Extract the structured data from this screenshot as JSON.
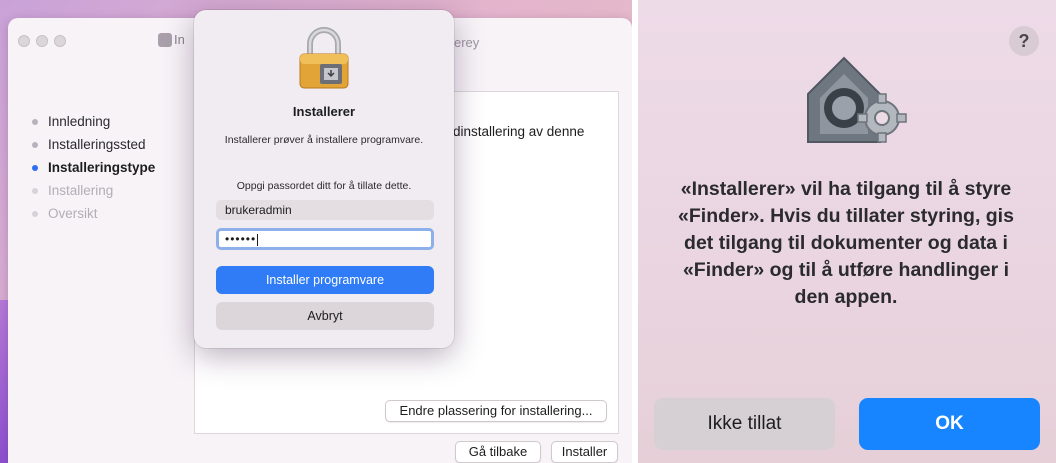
{
  "installer": {
    "window_title_left": "In",
    "window_title_right": "erey",
    "steps": [
      {
        "label": "Innledning",
        "state": "done"
      },
      {
        "label": "Installeringssted",
        "state": "done"
      },
      {
        "label": "Installeringstype",
        "state": "current"
      },
      {
        "label": "Installering",
        "state": "future"
      },
      {
        "label": "Oversikt",
        "state": "future"
      }
    ],
    "content_text": "dinstallering av denne",
    "change_location_button": "Endre plassering for installering...",
    "back_button": "Gå tilbake",
    "install_button": "Installer"
  },
  "auth_dialog": {
    "title": "Installerer",
    "message": "Installerer prøver å installere programvare.",
    "prompt": "Oppgi passordet ditt for å tillate dette.",
    "username": "brukeradmin",
    "password_masked": "••••••",
    "install_software_button": "Installer programvare",
    "cancel_button": "Avbryt"
  },
  "permission_dialog": {
    "help_symbol": "?",
    "message": "«Installerer» vil ha tilgang til å styre «Finder». Hvis du tillater styring, gis det tilgang til dokumenter og data i «Finder» og til å utføre handlinger i den appen.",
    "deny_button": "Ikke tillat",
    "ok_button": "OK"
  },
  "colors": {
    "accent_blue": "#2f7cf6",
    "ok_blue": "#1785ff",
    "current_step_dot": "#2f6ff0"
  }
}
